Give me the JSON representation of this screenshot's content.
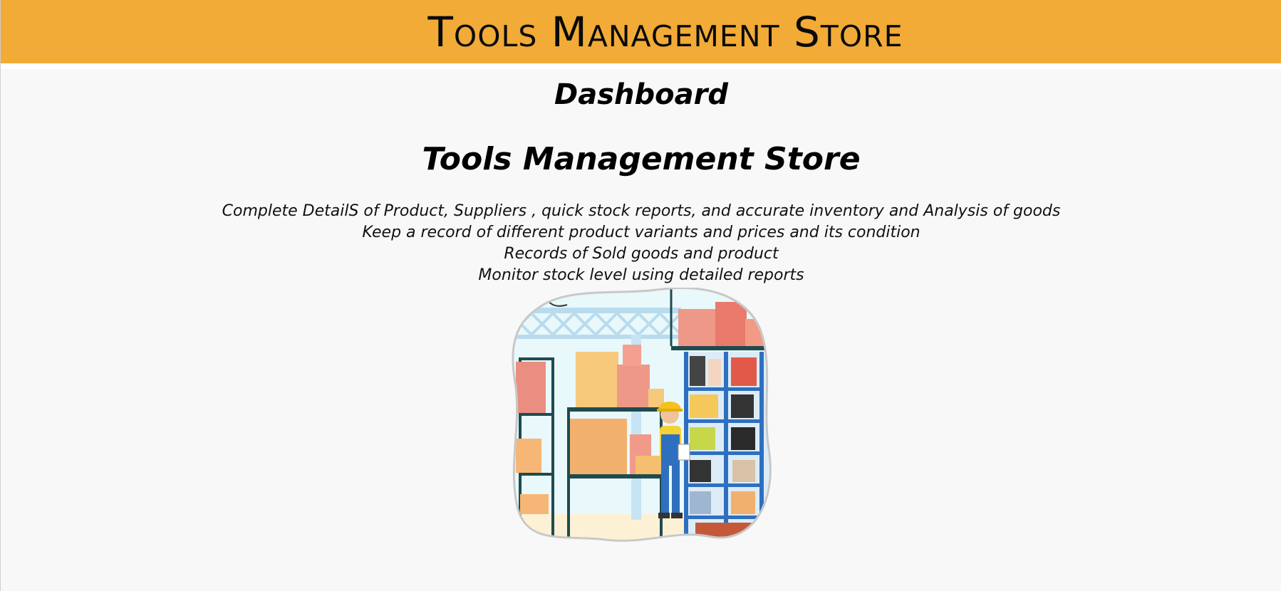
{
  "header": {
    "title": "Tools Management Store"
  },
  "page": {
    "heading": "Dashboard",
    "hero_title": "Tools Management Store",
    "features": [
      "Complete DetailS of Product, Suppliers , quick stock reports, and accurate inventory and Analysis of goods",
      "Keep a record of different product variants and prices and its condition",
      "Records of Sold goods and product",
      "Monitor stock level using detailed reports"
    ]
  },
  "colors": {
    "header_bg": "#f1ab36",
    "page_bg": "#f8f8f8"
  },
  "icons": {
    "illustration": "warehouse-worker-illustration"
  }
}
